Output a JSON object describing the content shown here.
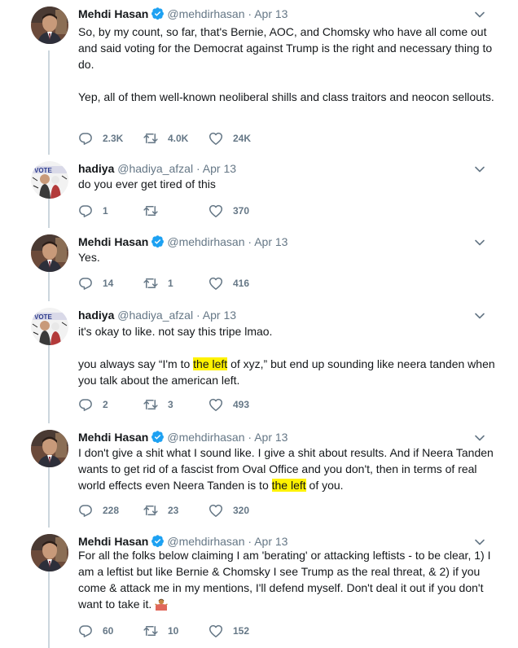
{
  "tweets": [
    {
      "name": "Mehdi Hasan",
      "handle": "@mehdirhasan",
      "sep": "·",
      "date": "Apr 13",
      "verified": true,
      "avatar": "avatar-mehdi",
      "p1": "So, by my count, so far, that's Bernie, AOC, and Chomsky who have all come out and said voting for the Democrat against Trump is the right and necessary thing to do.",
      "p2": "Yep, all of them well-known neoliberal shills and class traitors and neocon sellouts.",
      "replies": "2.3K",
      "retweets": "4.0K",
      "likes": "24K"
    },
    {
      "name": "hadiya",
      "handle": "@hadiya_afzal",
      "sep": "·",
      "date": "Apr 13",
      "verified": false,
      "avatar": "avatar-hadiya",
      "p1": "do you ever get tired of this",
      "replies": "1",
      "retweets": "",
      "likes": "370"
    },
    {
      "name": "Mehdi Hasan",
      "handle": "@mehdirhasan",
      "sep": "·",
      "date": "Apr 13",
      "verified": true,
      "avatar": "avatar-mehdi",
      "p1": "Yes.",
      "replies": "14",
      "retweets": "1",
      "likes": "416"
    },
    {
      "name": "hadiya",
      "handle": "@hadiya_afzal",
      "sep": "·",
      "date": "Apr 13",
      "verified": false,
      "avatar": "avatar-hadiya",
      "p1": "it's okay to like. not say this tripe lmao.",
      "p2a": "you always say “I'm to ",
      "p2hl": "the left",
      "p2b": " of xyz,” but end up sounding like neera tanden when you talk about the american left.",
      "replies": "2",
      "retweets": "3",
      "likes": "493"
    },
    {
      "name": "Mehdi Hasan",
      "handle": "@mehdirhasan",
      "sep": "·",
      "date": "Apr 13",
      "verified": true,
      "avatar": "avatar-mehdi",
      "p1a": "I don't give a shit what I sound like. I give a shit about results. And if Neera Tanden wants to get rid of a fascist from Oval Office and you don't, then in terms of real world effects even Neera Tanden is to ",
      "p1hl": "the left",
      "p1b": " of you.",
      "replies": "228",
      "retweets": "23",
      "likes": "320"
    },
    {
      "name": "Mehdi Hasan",
      "handle": "@mehdirhasan",
      "sep": "·",
      "date": "Apr 13",
      "verified": true,
      "avatar": "avatar-mehdi",
      "p1": "For all the folks below claiming I am 'berating' or attacking leftists - to be clear, 1) I am a leftist but like Bernie & Chomsky I see Trump as the real threat, & 2) if you come & attack me in my mentions, I'll defend myself. Don't deal it out if you don't want to take it.",
      "emoji": "man-shrugging-emoji",
      "replies": "60",
      "retweets": "10",
      "likes": "152"
    }
  ],
  "colors": {
    "text": "#14171a",
    "muted": "#657786",
    "verified": "#1da1f2",
    "highlight": "#fff200",
    "thread_line": "#ccd6dd"
  }
}
